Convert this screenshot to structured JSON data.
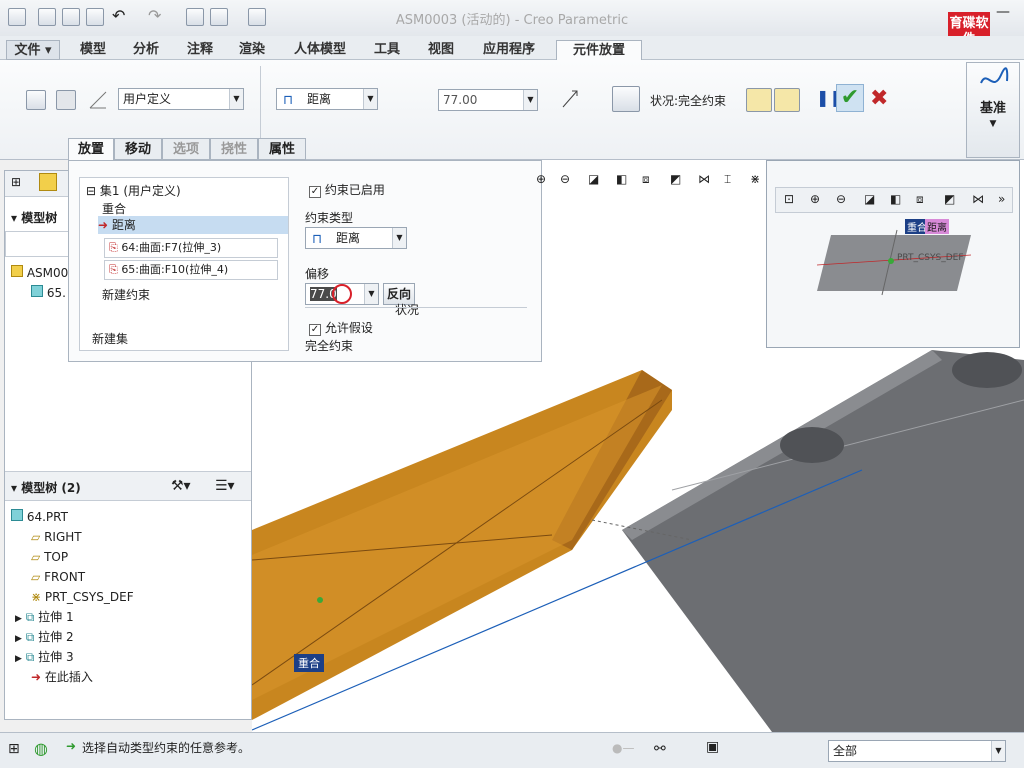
{
  "window": {
    "title": "ASM0003 (活动的) - Creo Parametric",
    "logo_text": "育碟软件"
  },
  "tabs": [
    "文件",
    "模型",
    "分析",
    "注释",
    "渲染",
    "人体模型",
    "工具",
    "视图",
    "应用程序",
    "元件放置"
  ],
  "ribbon": {
    "user_defined": "用户定义",
    "constraint_type": "距离",
    "offset_value": "77.00",
    "status": "状况:完全约束",
    "datum": "基准"
  },
  "subtabs": [
    "放置",
    "移动",
    "选项",
    "挠性",
    "属性"
  ],
  "placement": {
    "set_label": "集1 (用户定义)",
    "item_coincident": "重合",
    "item_distance": "距离",
    "ref1": "64:曲面:F7(拉伸_3)",
    "ref2": "65:曲面:F10(拉伸_4)",
    "new_constraint": "新建约束",
    "new_set": "新建集",
    "enabled_label": "约束已启用",
    "type_label": "约束类型",
    "type_value": "距离",
    "offset_label": "偏移",
    "offset_value": "77.0",
    "reverse": "反向",
    "status_caption": "状况",
    "allow_assume": "允许假设",
    "full_constraint": "完全约束"
  },
  "left_panel": {
    "tree_title": "模型树",
    "asm_label": "ASM00",
    "part_label": "65."
  },
  "tree2": {
    "title": "模型树 (2)",
    "items": [
      "64.PRT",
      "RIGHT",
      "TOP",
      "FRONT",
      "PRT_CSYS_DEF",
      "拉伸 1",
      "拉伸 2",
      "拉伸 3",
      "在此插入"
    ]
  },
  "mini_view": {
    "tag1": "重合",
    "tag2": "距离",
    "csys": "PRT_CSYS_DEF"
  },
  "viewport_tag": "重合",
  "status": {
    "message": "选择自动类型约束的任意参考。",
    "filter": "全部"
  },
  "colors": {
    "wood": "#c8861f",
    "steel": "#6c6e72",
    "accent_blue": "#1c5fb8",
    "check_green": "#2f9a2f",
    "cross_red": "#c0282a"
  }
}
